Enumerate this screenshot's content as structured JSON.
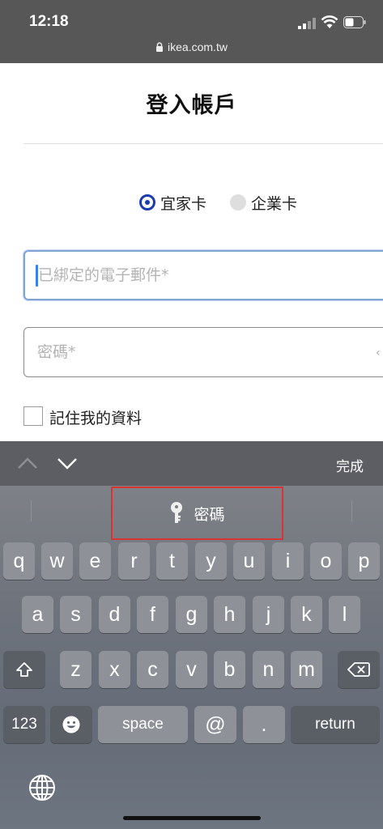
{
  "status_bar": {
    "time": "12:18",
    "url": "ikea.com.tw"
  },
  "page": {
    "title": "登入帳戶",
    "card_options": [
      {
        "label": "宜家卡",
        "selected": true
      },
      {
        "label": "企業卡",
        "selected": false
      }
    ],
    "email_placeholder": "已綁定的電子郵件*",
    "password_placeholder": "密碼*",
    "remember_label": "記住我的資料"
  },
  "keyboard": {
    "done_label": "完成",
    "suggestion": "密碼",
    "row1": [
      "q",
      "w",
      "e",
      "r",
      "t",
      "y",
      "u",
      "i",
      "o",
      "p"
    ],
    "row2": [
      "a",
      "s",
      "d",
      "f",
      "g",
      "h",
      "j",
      "k",
      "l"
    ],
    "row3": [
      "z",
      "x",
      "c",
      "v",
      "b",
      "n",
      "m"
    ],
    "numbers_label": "123",
    "space_label": "space",
    "at_label": "@",
    "dot_label": ".",
    "return_label": "return"
  },
  "colors": {
    "accent": "#1a3cb0",
    "status_bar": "#575757",
    "highlight": "#d93434"
  }
}
